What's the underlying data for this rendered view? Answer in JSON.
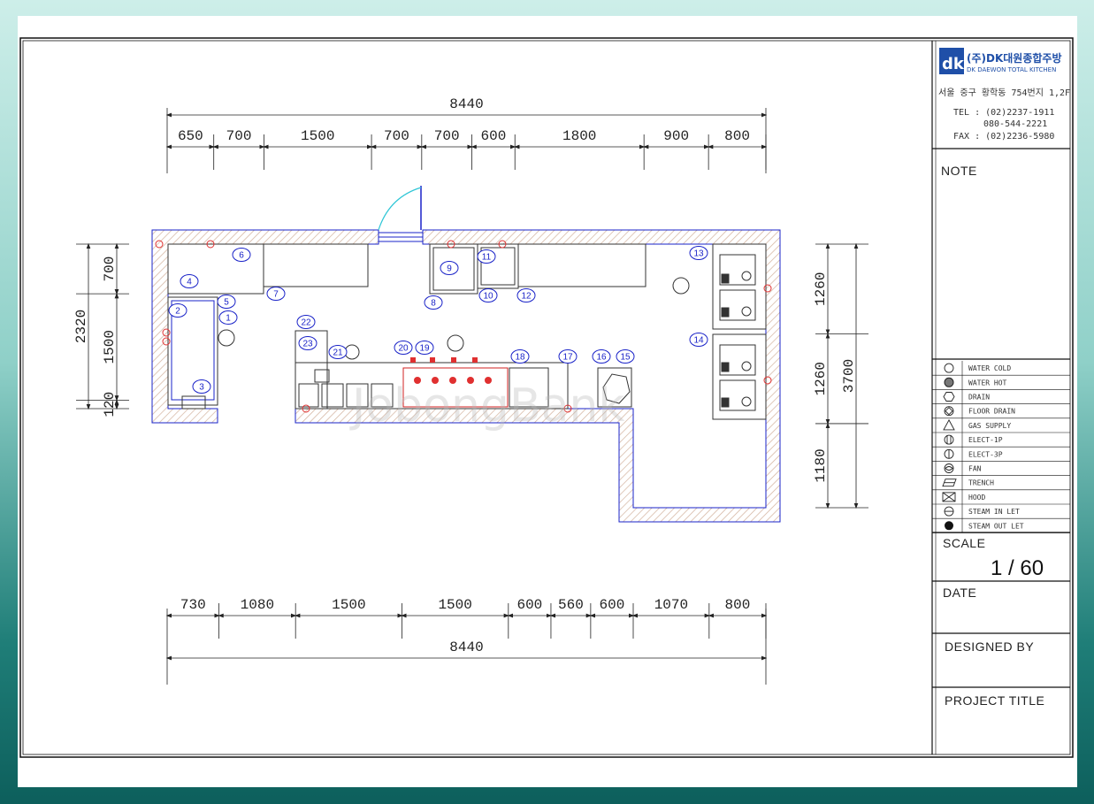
{
  "company": {
    "logo_mark": "dk",
    "name_kr": "(주)DK대원종합주방",
    "name_en": "DK DAEWON TOTAL KITCHEN",
    "address": "서울 중구 황학동 754번지 1,2F",
    "tel": "TEL : (02)2237-1911",
    "tel2": "080-544-2221",
    "fax": "FAX : (02)2236-5980"
  },
  "title_block": {
    "note_label": "NOTE",
    "scale_label": "SCALE",
    "scale_value": "1 / 60",
    "date_label": "DATE",
    "designed_by_label": "DESIGNED BY",
    "project_title_label": "PROJECT TITLE"
  },
  "legend": [
    {
      "symbol": "circle",
      "label": "WATER COLD"
    },
    {
      "symbol": "hatched-circle",
      "label": "WATER HOT"
    },
    {
      "symbol": "hexagon",
      "label": "DRAIN"
    },
    {
      "symbol": "diamond-circle",
      "label": "FLOOR DRAIN"
    },
    {
      "symbol": "triangle",
      "label": "GAS SUPPLY"
    },
    {
      "symbol": "circle-bars",
      "label": "ELECT-1P"
    },
    {
      "symbol": "circle-bar",
      "label": "ELECT-3P"
    },
    {
      "symbol": "fan",
      "label": "FAN"
    },
    {
      "symbol": "trench",
      "label": "TRENCH"
    },
    {
      "symbol": "x-box",
      "label": "HOOD"
    },
    {
      "symbol": "circle-split",
      "label": "STEAM IN LET"
    },
    {
      "symbol": "filled-circle",
      "label": "STEAM OUT LET"
    }
  ],
  "dimensions": {
    "top_total": "8440",
    "top_segments": [
      "650",
      "700",
      "1500",
      "700",
      "700",
      "600",
      "1800",
      "900",
      "800"
    ],
    "bottom_total": "8440",
    "bottom_segments": [
      "730",
      "1080",
      "1500",
      "1500",
      "600",
      "560",
      "600",
      "1070",
      "800"
    ],
    "left_total": "2320",
    "left_segments": [
      "700",
      "1500",
      "120"
    ],
    "right_total": "3700",
    "right_segments": [
      "1260",
      "1260",
      "1180"
    ]
  },
  "callouts": [
    "1",
    "2",
    "3",
    "4",
    "5",
    "6",
    "7",
    "8",
    "9",
    "10",
    "11",
    "12",
    "13",
    "14",
    "15",
    "16",
    "17",
    "18",
    "19",
    "20",
    "21",
    "22",
    "23"
  ],
  "watermark": "JobongBank"
}
